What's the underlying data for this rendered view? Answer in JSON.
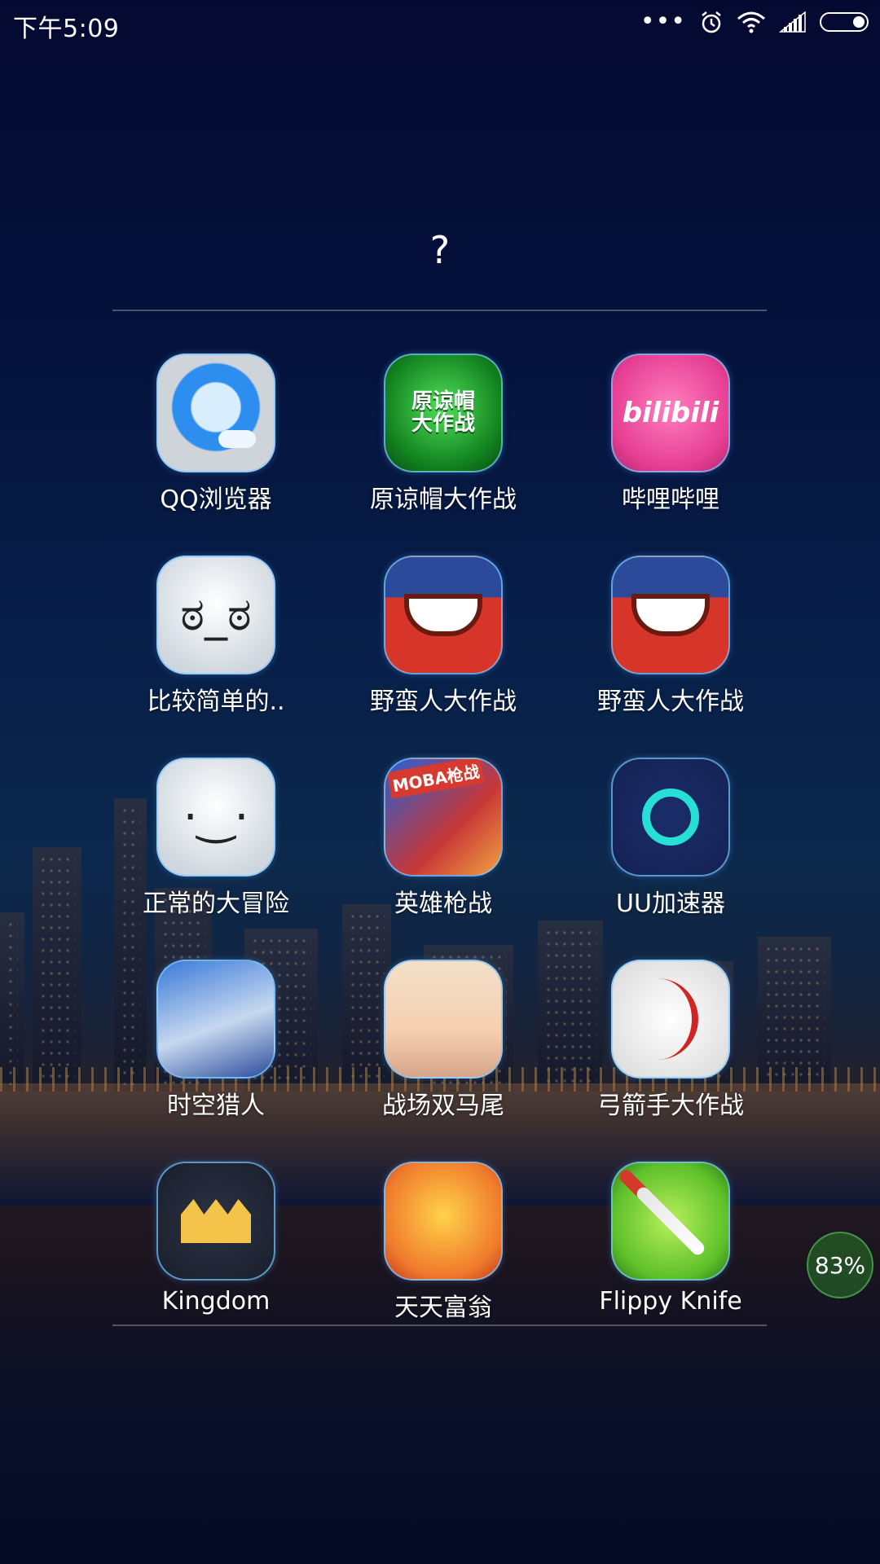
{
  "status_bar": {
    "time": "下午5:09",
    "icons": [
      "more-dots-icon",
      "alarm-icon",
      "wifi-icon",
      "signal-icon",
      "battery-icon"
    ]
  },
  "folder": {
    "title": "?"
  },
  "apps": [
    {
      "label": "QQ浏览器",
      "icon": "qq-browser-icon"
    },
    {
      "label": "原谅帽大作战",
      "icon": "yuanliangmao-game-icon"
    },
    {
      "label": "哔哩哔哩",
      "icon": "bilibili-icon"
    },
    {
      "label": "比较简单的..",
      "icon": "meme-face-icon"
    },
    {
      "label": "野蛮人大作战",
      "icon": "barbarian-game-trial-icon"
    },
    {
      "label": "野蛮人大作战",
      "icon": "barbarian-game-icon"
    },
    {
      "label": "正常的大冒险",
      "icon": "meme-face-icon"
    },
    {
      "label": "英雄枪战",
      "icon": "hero-shooter-icon"
    },
    {
      "label": "UU加速器",
      "icon": "uu-accelerator-icon"
    },
    {
      "label": "时空猎人",
      "icon": "time-hunter-icon"
    },
    {
      "label": "战场双马尾",
      "icon": "twin-tails-icon"
    },
    {
      "label": "弓箭手大作战",
      "icon": "archer-game-icon"
    },
    {
      "label": "Kingdom",
      "icon": "kingdom-crown-icon"
    },
    {
      "label": "天天富翁",
      "icon": "tiantian-fuweng-icon"
    },
    {
      "label": "Flippy Knife",
      "icon": "flippy-knife-icon"
    }
  ],
  "icon_text": {
    "yuan": "原谅帽\n大作战",
    "bili": "bilibili",
    "moba": "MOBA枪战"
  },
  "memory_badge": "83%"
}
